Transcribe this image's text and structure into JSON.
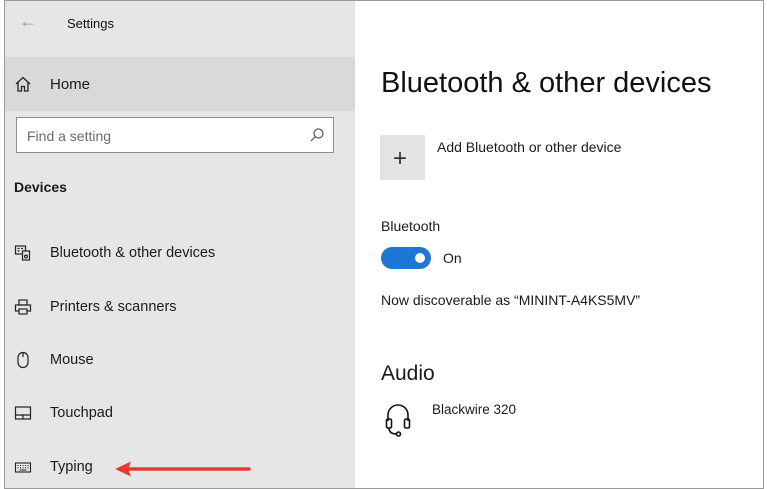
{
  "window": {
    "title": "Settings"
  },
  "sidebar": {
    "home_label": "Home",
    "search_placeholder": "Find a setting",
    "section_title": "Devices",
    "items": [
      {
        "label": "Bluetooth & other devices",
        "icon": "bluetooth-devices-icon"
      },
      {
        "label": "Printers & scanners",
        "icon": "printer-icon"
      },
      {
        "label": "Mouse",
        "icon": "mouse-icon"
      },
      {
        "label": "Touchpad",
        "icon": "touchpad-icon"
      },
      {
        "label": "Typing",
        "icon": "keyboard-icon"
      }
    ]
  },
  "main": {
    "title": "Bluetooth & other devices",
    "add_device_label": "Add Bluetooth or other device",
    "bluetooth_label": "Bluetooth",
    "toggle_state": "On",
    "discoverable_text": "Now discoverable as “MININT-A4KS5MV”",
    "audio_heading": "Audio",
    "audio_devices": [
      {
        "name": "Blackwire 320",
        "icon": "headset-icon"
      }
    ]
  },
  "colors": {
    "accent": "#1e76d6",
    "annotation_arrow": "#e53935",
    "sidebar_bg": "#e6e6e6"
  }
}
